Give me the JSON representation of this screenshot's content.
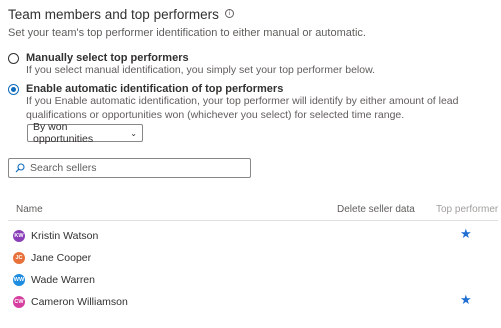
{
  "section": {
    "title": "Team members and top performers",
    "info_icon": "info-icon",
    "subtitle": "Set your team's top performer identification to either manual or automatic."
  },
  "options": {
    "manual": {
      "label": "Manually select top performers",
      "help": "If you select manual identification, you simply set your top performer below.",
      "selected": false
    },
    "automatic": {
      "label": "Enable automatic identification of top performers",
      "help": "If you Enable automatic identification, your top performer will identify by either amount of lead qualifications or opportunities won (whichever you select) for selected time range.",
      "selected": true
    }
  },
  "dropdown": {
    "value": "By won opportunities",
    "icon": "chevron-down-icon"
  },
  "search": {
    "placeholder": "Search sellers",
    "icon": "search-icon"
  },
  "table": {
    "headers": {
      "name": "Name",
      "delete": "Delete seller data",
      "top": "Top performer"
    },
    "rows": [
      {
        "initials": "KW",
        "name": "Kristin Watson",
        "avatar_color": "#8a3fb8",
        "top_performer": true
      },
      {
        "initials": "JC",
        "name": "Jane Cooper",
        "avatar_color": "#e8703a",
        "top_performer": false
      },
      {
        "initials": "WW",
        "name": "Wade Warren",
        "avatar_color": "#1e8ce0",
        "top_performer": false
      },
      {
        "initials": "CW",
        "name": "Cameron Williamson",
        "avatar_color": "#d63f9f",
        "top_performer": true
      }
    ]
  },
  "colors": {
    "accent": "#0f6cbd",
    "star": "#1f6ed4",
    "divider": "#e1dfdd"
  }
}
